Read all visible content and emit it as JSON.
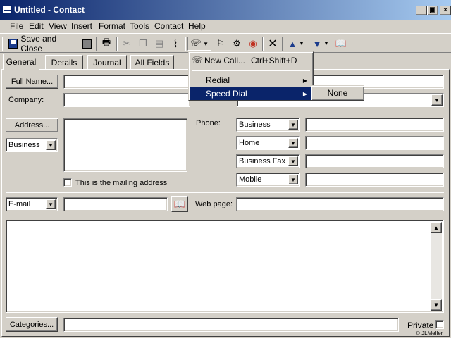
{
  "window": {
    "title": "Untitled - Contact",
    "controls": [
      "_",
      "▣",
      "×"
    ]
  },
  "menubar": {
    "items": [
      "File",
      "Edit",
      "View",
      "Insert",
      "Format",
      "Tools",
      "Contact",
      "Help"
    ]
  },
  "toolbar": {
    "save_close_label": "Save and Close",
    "icons": [
      "save-disk-icon",
      "print-icon",
      "cut-icon",
      "copy-icon",
      "paste-icon",
      "paperclip-icon",
      "phone-icon",
      "dropdown-arrow-icon",
      "follow-up-icon",
      "organize-icon",
      "delete-icon",
      "previous-item-icon",
      "next-item-icon",
      "address-book-icon"
    ]
  },
  "tabs": [
    "General",
    "Details",
    "Journal",
    "All Fields"
  ],
  "general": {
    "full_name_button": "Full Name...",
    "full_name_value": "",
    "company_label": "Company:",
    "company_value": "",
    "address_button": "Address...",
    "address_type": "Business",
    "address_value": "",
    "mailing_checkbox_label": "This is the mailing address",
    "mailing_checked": false,
    "phone_label": "Phone:",
    "phones": [
      {
        "type": "Business",
        "value": ""
      },
      {
        "type": "Home",
        "value": ""
      },
      {
        "type": "Business Fax",
        "value": ""
      },
      {
        "type": "Mobile",
        "value": ""
      }
    ],
    "email_type": "E-mail",
    "email_value": "",
    "webpage_label": "Web page:",
    "webpage_value": "",
    "notes_value": "",
    "categories_button": "Categories...",
    "categories_value": "",
    "private_label": "Private",
    "private_checked": false
  },
  "call_menu": {
    "items": [
      {
        "label": "New Call...",
        "shortcut": "Ctrl+Shift+D",
        "submenu": false,
        "highlighted": false
      },
      {
        "label": "Redial",
        "shortcut": "",
        "submenu": true,
        "highlighted": false
      },
      {
        "label": "Speed Dial",
        "shortcut": "",
        "submenu": true,
        "highlighted": true
      }
    ],
    "speed_dial_submenu": [
      "None"
    ]
  },
  "watermark": "© JLMeller",
  "colors": {
    "titlebar_start": "#0a246a",
    "titlebar_end": "#a6caf0",
    "menu_highlight": "#0a246a",
    "face": "#d4d0c8"
  }
}
